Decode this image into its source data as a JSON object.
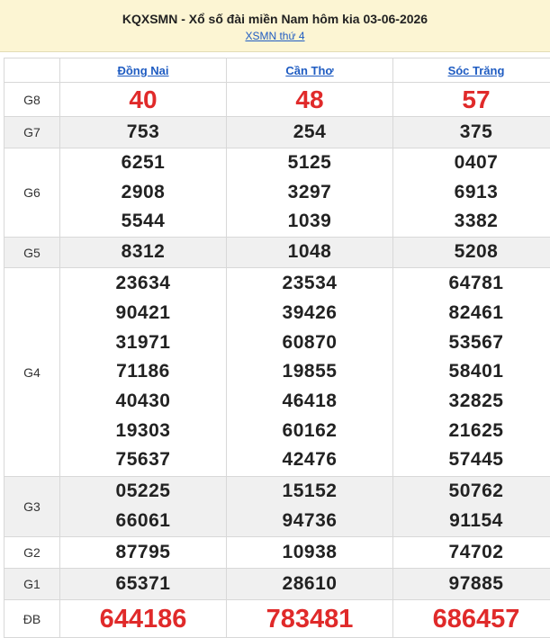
{
  "header": {
    "title": "KQXSMN - Xổ số đài miền Nam hôm kia 03-06-2026",
    "link": "XSMN thứ 4"
  },
  "provinces": [
    "Đồng Nai",
    "Cần Thơ",
    "Sóc Trăng"
  ],
  "prizes": {
    "g8": {
      "label": "G8",
      "values": [
        [
          "40"
        ],
        [
          "48"
        ],
        [
          "57"
        ]
      ]
    },
    "g7": {
      "label": "G7",
      "values": [
        [
          "753"
        ],
        [
          "254"
        ],
        [
          "375"
        ]
      ]
    },
    "g6": {
      "label": "G6",
      "values": [
        [
          "6251",
          "2908",
          "5544"
        ],
        [
          "5125",
          "3297",
          "1039"
        ],
        [
          "0407",
          "6913",
          "3382"
        ]
      ]
    },
    "g5": {
      "label": "G5",
      "values": [
        [
          "8312"
        ],
        [
          "1048"
        ],
        [
          "5208"
        ]
      ]
    },
    "g4": {
      "label": "G4",
      "values": [
        [
          "23634",
          "90421",
          "31971",
          "71186",
          "40430",
          "19303",
          "75637"
        ],
        [
          "23534",
          "39426",
          "60870",
          "19855",
          "46418",
          "60162",
          "42476"
        ],
        [
          "64781",
          "82461",
          "53567",
          "58401",
          "32825",
          "21625",
          "57445"
        ]
      ]
    },
    "g3": {
      "label": "G3",
      "values": [
        [
          "05225",
          "66061"
        ],
        [
          "15152",
          "94736"
        ],
        [
          "50762",
          "91154"
        ]
      ]
    },
    "g2": {
      "label": "G2",
      "values": [
        [
          "87795"
        ],
        [
          "10938"
        ],
        [
          "74702"
        ]
      ]
    },
    "g1": {
      "label": "G1",
      "values": [
        [
          "65371"
        ],
        [
          "28610"
        ],
        [
          "97885"
        ]
      ]
    },
    "db": {
      "label": "ĐB",
      "values": [
        [
          "644186"
        ],
        [
          "783481"
        ],
        [
          "686457"
        ]
      ]
    }
  },
  "colors": {
    "header_bg": "#fcf5d3",
    "link": "#1f5cc2",
    "highlight": "#e02a2a",
    "row_shade": "#f0f0f0"
  }
}
